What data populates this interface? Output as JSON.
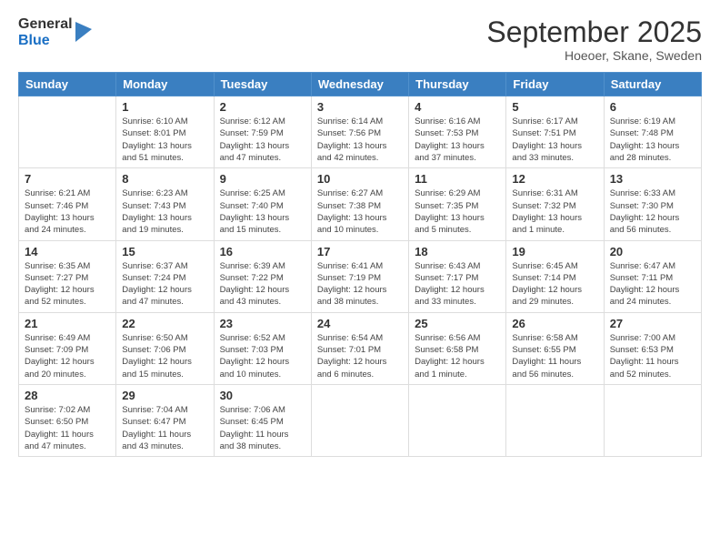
{
  "logo": {
    "general": "General",
    "blue": "Blue"
  },
  "title": "September 2025",
  "location": "Hoeoer, Skane, Sweden",
  "days_header": [
    "Sunday",
    "Monday",
    "Tuesday",
    "Wednesday",
    "Thursday",
    "Friday",
    "Saturday"
  ],
  "weeks": [
    [
      {
        "day": "",
        "sunrise": "",
        "sunset": "",
        "daylight": ""
      },
      {
        "day": "1",
        "sunrise": "Sunrise: 6:10 AM",
        "sunset": "Sunset: 8:01 PM",
        "daylight": "Daylight: 13 hours and 51 minutes."
      },
      {
        "day": "2",
        "sunrise": "Sunrise: 6:12 AM",
        "sunset": "Sunset: 7:59 PM",
        "daylight": "Daylight: 13 hours and 47 minutes."
      },
      {
        "day": "3",
        "sunrise": "Sunrise: 6:14 AM",
        "sunset": "Sunset: 7:56 PM",
        "daylight": "Daylight: 13 hours and 42 minutes."
      },
      {
        "day": "4",
        "sunrise": "Sunrise: 6:16 AM",
        "sunset": "Sunset: 7:53 PM",
        "daylight": "Daylight: 13 hours and 37 minutes."
      },
      {
        "day": "5",
        "sunrise": "Sunrise: 6:17 AM",
        "sunset": "Sunset: 7:51 PM",
        "daylight": "Daylight: 13 hours and 33 minutes."
      },
      {
        "day": "6",
        "sunrise": "Sunrise: 6:19 AM",
        "sunset": "Sunset: 7:48 PM",
        "daylight": "Daylight: 13 hours and 28 minutes."
      }
    ],
    [
      {
        "day": "7",
        "sunrise": "Sunrise: 6:21 AM",
        "sunset": "Sunset: 7:46 PM",
        "daylight": "Daylight: 13 hours and 24 minutes."
      },
      {
        "day": "8",
        "sunrise": "Sunrise: 6:23 AM",
        "sunset": "Sunset: 7:43 PM",
        "daylight": "Daylight: 13 hours and 19 minutes."
      },
      {
        "day": "9",
        "sunrise": "Sunrise: 6:25 AM",
        "sunset": "Sunset: 7:40 PM",
        "daylight": "Daylight: 13 hours and 15 minutes."
      },
      {
        "day": "10",
        "sunrise": "Sunrise: 6:27 AM",
        "sunset": "Sunset: 7:38 PM",
        "daylight": "Daylight: 13 hours and 10 minutes."
      },
      {
        "day": "11",
        "sunrise": "Sunrise: 6:29 AM",
        "sunset": "Sunset: 7:35 PM",
        "daylight": "Daylight: 13 hours and 5 minutes."
      },
      {
        "day": "12",
        "sunrise": "Sunrise: 6:31 AM",
        "sunset": "Sunset: 7:32 PM",
        "daylight": "Daylight: 13 hours and 1 minute."
      },
      {
        "day": "13",
        "sunrise": "Sunrise: 6:33 AM",
        "sunset": "Sunset: 7:30 PM",
        "daylight": "Daylight: 12 hours and 56 minutes."
      }
    ],
    [
      {
        "day": "14",
        "sunrise": "Sunrise: 6:35 AM",
        "sunset": "Sunset: 7:27 PM",
        "daylight": "Daylight: 12 hours and 52 minutes."
      },
      {
        "day": "15",
        "sunrise": "Sunrise: 6:37 AM",
        "sunset": "Sunset: 7:24 PM",
        "daylight": "Daylight: 12 hours and 47 minutes."
      },
      {
        "day": "16",
        "sunrise": "Sunrise: 6:39 AM",
        "sunset": "Sunset: 7:22 PM",
        "daylight": "Daylight: 12 hours and 43 minutes."
      },
      {
        "day": "17",
        "sunrise": "Sunrise: 6:41 AM",
        "sunset": "Sunset: 7:19 PM",
        "daylight": "Daylight: 12 hours and 38 minutes."
      },
      {
        "day": "18",
        "sunrise": "Sunrise: 6:43 AM",
        "sunset": "Sunset: 7:17 PM",
        "daylight": "Daylight: 12 hours and 33 minutes."
      },
      {
        "day": "19",
        "sunrise": "Sunrise: 6:45 AM",
        "sunset": "Sunset: 7:14 PM",
        "daylight": "Daylight: 12 hours and 29 minutes."
      },
      {
        "day": "20",
        "sunrise": "Sunrise: 6:47 AM",
        "sunset": "Sunset: 7:11 PM",
        "daylight": "Daylight: 12 hours and 24 minutes."
      }
    ],
    [
      {
        "day": "21",
        "sunrise": "Sunrise: 6:49 AM",
        "sunset": "Sunset: 7:09 PM",
        "daylight": "Daylight: 12 hours and 20 minutes."
      },
      {
        "day": "22",
        "sunrise": "Sunrise: 6:50 AM",
        "sunset": "Sunset: 7:06 PM",
        "daylight": "Daylight: 12 hours and 15 minutes."
      },
      {
        "day": "23",
        "sunrise": "Sunrise: 6:52 AM",
        "sunset": "Sunset: 7:03 PM",
        "daylight": "Daylight: 12 hours and 10 minutes."
      },
      {
        "day": "24",
        "sunrise": "Sunrise: 6:54 AM",
        "sunset": "Sunset: 7:01 PM",
        "daylight": "Daylight: 12 hours and 6 minutes."
      },
      {
        "day": "25",
        "sunrise": "Sunrise: 6:56 AM",
        "sunset": "Sunset: 6:58 PM",
        "daylight": "Daylight: 12 hours and 1 minute."
      },
      {
        "day": "26",
        "sunrise": "Sunrise: 6:58 AM",
        "sunset": "Sunset: 6:55 PM",
        "daylight": "Daylight: 11 hours and 56 minutes."
      },
      {
        "day": "27",
        "sunrise": "Sunrise: 7:00 AM",
        "sunset": "Sunset: 6:53 PM",
        "daylight": "Daylight: 11 hours and 52 minutes."
      }
    ],
    [
      {
        "day": "28",
        "sunrise": "Sunrise: 7:02 AM",
        "sunset": "Sunset: 6:50 PM",
        "daylight": "Daylight: 11 hours and 47 minutes."
      },
      {
        "day": "29",
        "sunrise": "Sunrise: 7:04 AM",
        "sunset": "Sunset: 6:47 PM",
        "daylight": "Daylight: 11 hours and 43 minutes."
      },
      {
        "day": "30",
        "sunrise": "Sunrise: 7:06 AM",
        "sunset": "Sunset: 6:45 PM",
        "daylight": "Daylight: 11 hours and 38 minutes."
      },
      {
        "day": "",
        "sunrise": "",
        "sunset": "",
        "daylight": ""
      },
      {
        "day": "",
        "sunrise": "",
        "sunset": "",
        "daylight": ""
      },
      {
        "day": "",
        "sunrise": "",
        "sunset": "",
        "daylight": ""
      },
      {
        "day": "",
        "sunrise": "",
        "sunset": "",
        "daylight": ""
      }
    ]
  ]
}
